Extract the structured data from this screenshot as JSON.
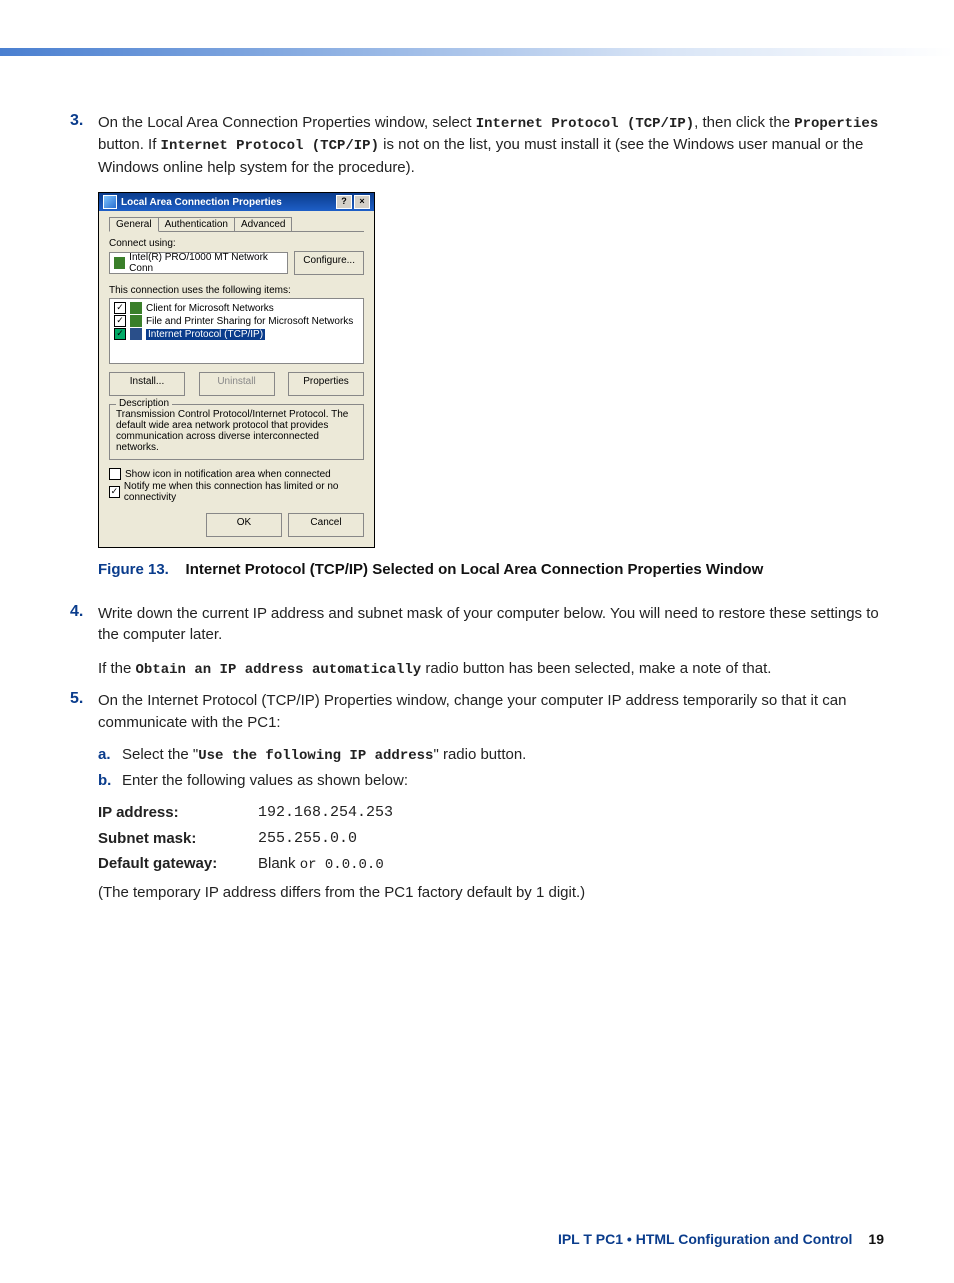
{
  "step3": {
    "num": "3.",
    "text_a": "On the Local Area Connection Properties window, select ",
    "mono_a": "Internet Protocol (TCP/IP)",
    "text_b": ", then click the ",
    "mono_b": "Properties",
    "text_c": " button. If ",
    "mono_c": "Internet Protocol (TCP/IP)",
    "text_d": " is not on the list, you must install it (see the Windows user manual or the Windows online help system for the procedure)."
  },
  "dialog": {
    "title": "Local Area Connection Properties",
    "help_btn": "?",
    "close_btn": "×",
    "tabs": {
      "general": "General",
      "auth": "Authentication",
      "adv": "Advanced"
    },
    "connect_using_label": "Connect using:",
    "adapter": "Intel(R) PRO/1000 MT Network Conn",
    "configure_btn": "Configure...",
    "items_label": "This connection uses the following items:",
    "items": {
      "a": "Client for Microsoft Networks",
      "b": "File and Printer Sharing for Microsoft Networks",
      "c": "Internet Protocol (TCP/IP)"
    },
    "install_btn": "Install...",
    "uninstall_btn": "Uninstall",
    "properties_btn": "Properties",
    "desc_legend": "Description",
    "desc_text": "Transmission Control Protocol/Internet Protocol. The default wide area network protocol that provides communication across diverse interconnected networks.",
    "show_icon": "Show icon in notification area when connected",
    "notify": "Notify me when this connection has limited or no connectivity",
    "ok_btn": "OK",
    "cancel_btn": "Cancel"
  },
  "figure": {
    "label": "Figure 13.",
    "title": "Internet Protocol (TCP/IP) Selected on Local Area Connection Properties Window"
  },
  "step4": {
    "num": "4.",
    "text": "Write down the current IP address and subnet mask of your computer below. You will need to restore these settings to the computer later.",
    "note_a": "If the ",
    "mono": "Obtain an IP address automatically",
    "note_b": " radio button has been selected, make a note of that."
  },
  "step5": {
    "num": "5.",
    "text": "On the Internet Protocol (TCP/IP) Properties window, change your computer IP address temporarily so that it can communicate with the PC1:",
    "a": {
      "k": "a.",
      "pre": "Select the \"",
      "mono": "Use the following IP address",
      "post": "\" radio button."
    },
    "b": {
      "k": "b.",
      "text": "Enter the following values as shown below:"
    },
    "ip": {
      "k1": "IP address:",
      "v1": "192.168.254.253",
      "k2": "Subnet mask:",
      "v2": "255.255.0.0",
      "k3": "Default gateway:",
      "v3_pre": "Blank ",
      "v3_mono": "or 0.0.0.0"
    },
    "paren": "(The temporary IP address differs from the PC1 factory default by 1 digit.)"
  },
  "footer": {
    "text": "IPL T PC1 • HTML Configuration and Control",
    "page": "19"
  }
}
